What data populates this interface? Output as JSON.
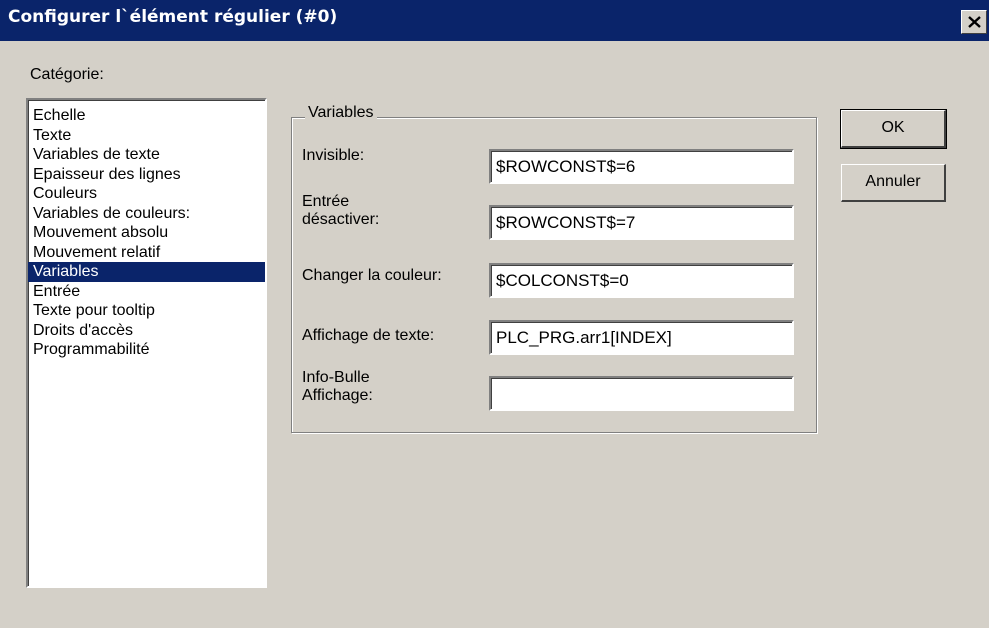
{
  "window": {
    "title": "Configurer l`élément régulier (#0)",
    "close_icon": "close-icon"
  },
  "category": {
    "label": "Catégorie:",
    "items": [
      "Echelle",
      "Texte",
      "Variables de texte",
      "Epaisseur des lignes",
      "Couleurs",
      "Variables de couleurs:",
      "Mouvement absolu",
      "Mouvement relatif",
      "Variables",
      "Entrée",
      "Texte pour tooltip",
      "Droits d'accès",
      "Programmabilité"
    ],
    "selected": "Variables"
  },
  "variables": {
    "group_label": "Variables",
    "invisible": {
      "label": "Invisible:",
      "value": "$ROWCONST$=6"
    },
    "entree_desactiver": {
      "label_line1": "Entrée",
      "label_line2": "désactiver:",
      "value": "$ROWCONST$=7"
    },
    "changer_couleur": {
      "label": "Changer la couleur:",
      "value": "$COLCONST$=0"
    },
    "affichage_texte": {
      "label": "Affichage de texte:",
      "value": "PLC_PRG.arr1[INDEX]"
    },
    "info_bulle": {
      "label_line1": "Info-Bulle",
      "label_line2": "Affichage:",
      "value": ""
    }
  },
  "buttons": {
    "ok": "OK",
    "cancel": "Annuler"
  },
  "colors": {
    "titlebar": "#0a246a",
    "face": "#d4d0c8",
    "selection": "#0a246a"
  }
}
